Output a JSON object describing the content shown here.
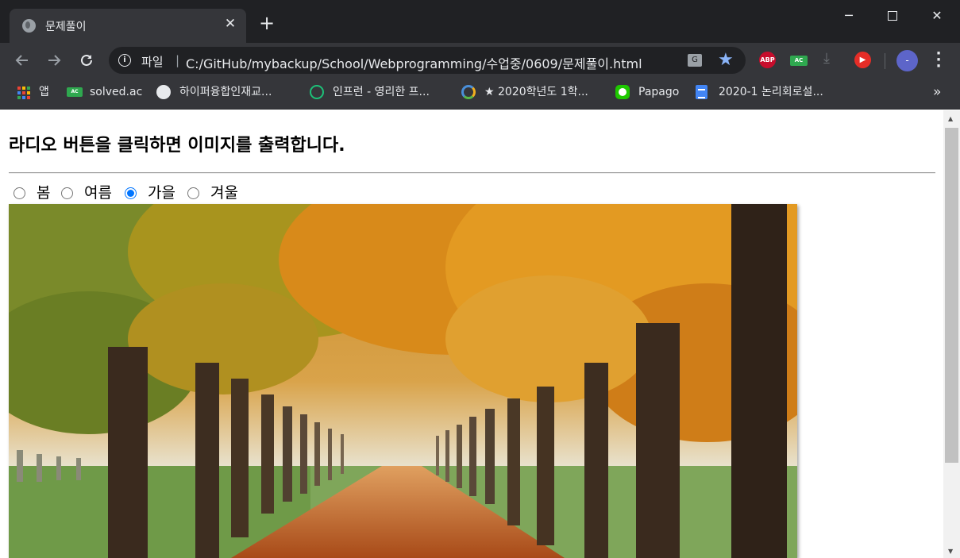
{
  "tab": {
    "title": "문제풀이",
    "close_glyph": "✕"
  },
  "new_tab_glyph": "+",
  "window_controls": {
    "minimize": "─",
    "close": "✕"
  },
  "address_bar": {
    "scheme_label": "파일",
    "separator": "|",
    "url": "C:/GitHub/mybackup/School/Webprogramming/수업중/0609/문제풀이.html"
  },
  "extensions": {
    "abp_label": "ABP",
    "ac_label": "AC",
    "profile_label": "-"
  },
  "bookmarks": [
    {
      "label": "앱",
      "icon": "apps-icon"
    },
    {
      "label": "solved.ac",
      "icon": "solved-ac-icon"
    },
    {
      "label": "하이퍼융합인재교...",
      "icon": "globe-icon"
    },
    {
      "label": "인프런 - 영리한 프...",
      "icon": "inflearn-icon"
    },
    {
      "label": "★ 2020학년도 1학...",
      "icon": "ring-logo-icon"
    },
    {
      "label": "Papago",
      "icon": "papago-icon"
    },
    {
      "label": "2020-1 논리회로설...",
      "icon": "docs-icon"
    }
  ],
  "bookmarks_more": "»",
  "page": {
    "heading": "라디오 버튼을 클릭하면 이미지를 출력합니다.",
    "radio_options": [
      {
        "label": "봄",
        "checked": false
      },
      {
        "label": "여름",
        "checked": false
      },
      {
        "label": "가을",
        "checked": true
      },
      {
        "label": "겨울",
        "checked": false
      }
    ],
    "image_subject": "autumn tree-lined path"
  },
  "colors": {
    "chrome_dark": "#202124",
    "chrome_toolbar": "#35363a",
    "radio_checked": "#0075ff",
    "star": "#8ab4f8"
  }
}
